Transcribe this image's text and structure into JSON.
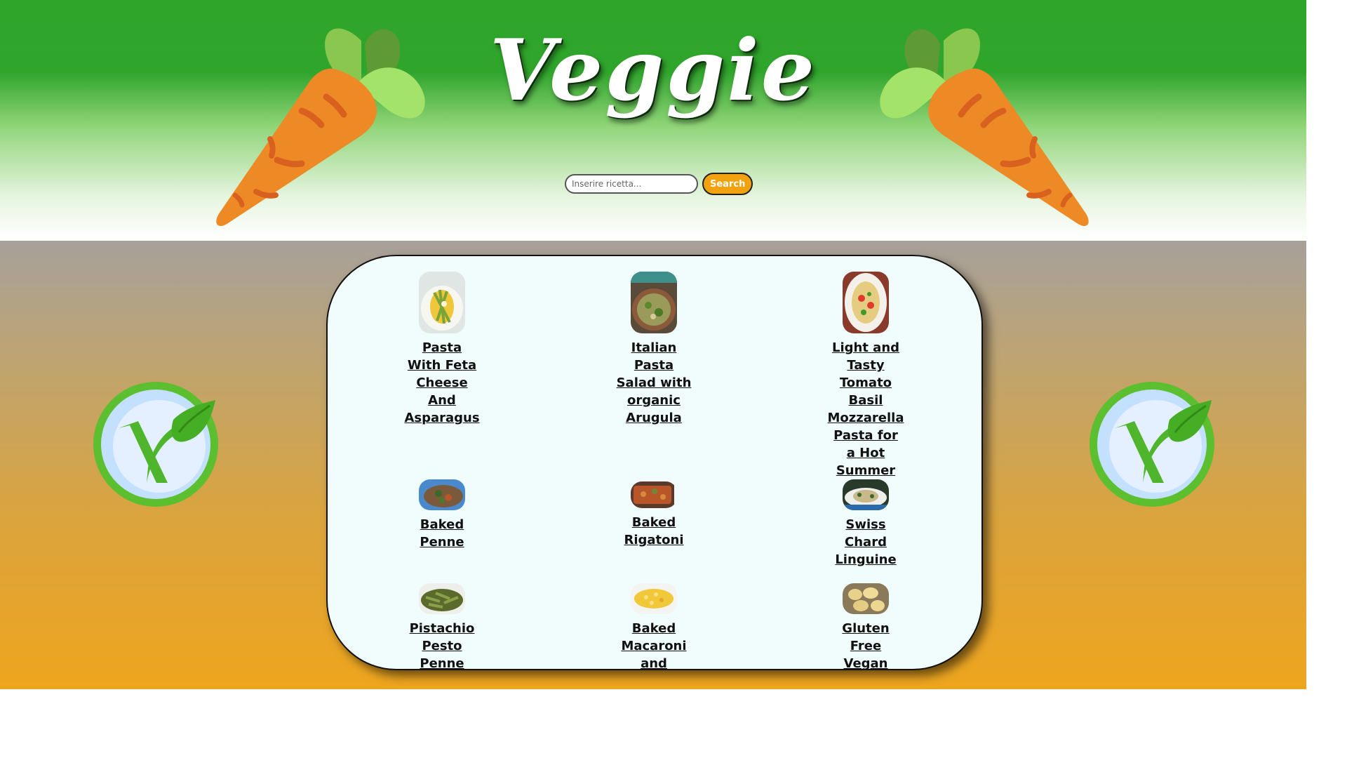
{
  "header": {
    "title": "Veggie",
    "search": {
      "placeholder": "Inserire ricetta...",
      "value": "",
      "button_label": "Search"
    }
  },
  "recipes": [
    {
      "title": "Pasta With Feta Cheese And Asparagus",
      "image": "pasta-feta-asparagus-photo"
    },
    {
      "title": "Italian Pasta Salad with organic Arugula",
      "image": "pasta-salad-arugula-photo"
    },
    {
      "title": "Light and Tasty Tomato Basil Mozzarella Pasta for a Hot Summer Day",
      "image": "tomato-basil-mozzarella-pasta-photo"
    },
    {
      "title": "Baked Penne",
      "image": "baked-penne-photo"
    },
    {
      "title": "Baked Rigatoni",
      "image": "baked-rigatoni-photo"
    },
    {
      "title": "Swiss Chard Linguine",
      "image": "swiss-chard-linguine-photo"
    },
    {
      "title": "Pistachio Pesto Penne",
      "image": "pistachio-pesto-penne-photo"
    },
    {
      "title": "Baked Macaroni and Cheese",
      "image": "baked-macaroni-cheese-photo"
    },
    {
      "title": "Gluten Free Vegan Gnocchi",
      "image": "vegan-gnocchi-photo"
    }
  ],
  "decorations": {
    "carrot_icon": "carrot-icon",
    "vegan_icon": "vegan-v-icon",
    "colors": {
      "header_green": "#2ea62a",
      "button_orange": "#f2a20e",
      "panel_bg": "#f0fdfc",
      "carrot_orange": "#ed8a26",
      "leaf_green": "#8ad35c"
    }
  }
}
